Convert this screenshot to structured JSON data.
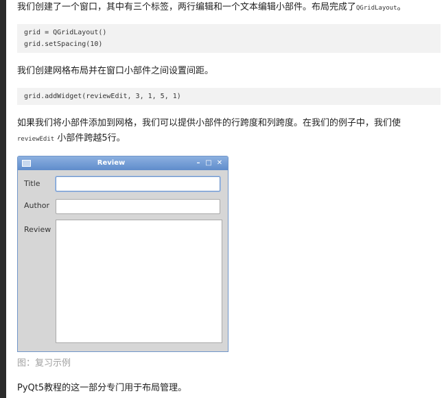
{
  "article": {
    "para1_text": "我们创建了一个窗口，其中有三个标签，两行编辑和一个文本编辑小部件。布局完成了",
    "para1_code": "QGridLayout",
    "para1_end": "。",
    "code1_line1": "grid = QGridLayout()",
    "code1_line2": "grid.setSpacing(10)",
    "para2_text": "我们创建网格布局并在窗口小部件之间设置间距。",
    "code2_line1": "grid.addWidget(reviewEdit, 3, 1, 5, 1)",
    "para3_line1": "如果我们将小部件添加到网格，我们可以提供小部件的行跨度和列跨度。在我们的例子中，我们使",
    "para3_code": "reviewEdit",
    "para3_line2": " 小部件跨越5行。",
    "caption": "图：复习示例",
    "para4_text": "PyQt5教程的这一部分专门用于布局管理。"
  },
  "qt_window": {
    "title": "Review",
    "minimize_glyph": "–",
    "maximize_glyph": "□",
    "close_glyph": "✕",
    "label_title": "Title",
    "label_author": "Author",
    "label_review": "Review",
    "title_value": "",
    "author_value": "",
    "review_value": ""
  },
  "colors": {
    "titlebar": "#6f95c9",
    "window_bg": "#d6d6d6",
    "code_bg": "#f2f2f2",
    "caption": "#a0a0a0"
  }
}
